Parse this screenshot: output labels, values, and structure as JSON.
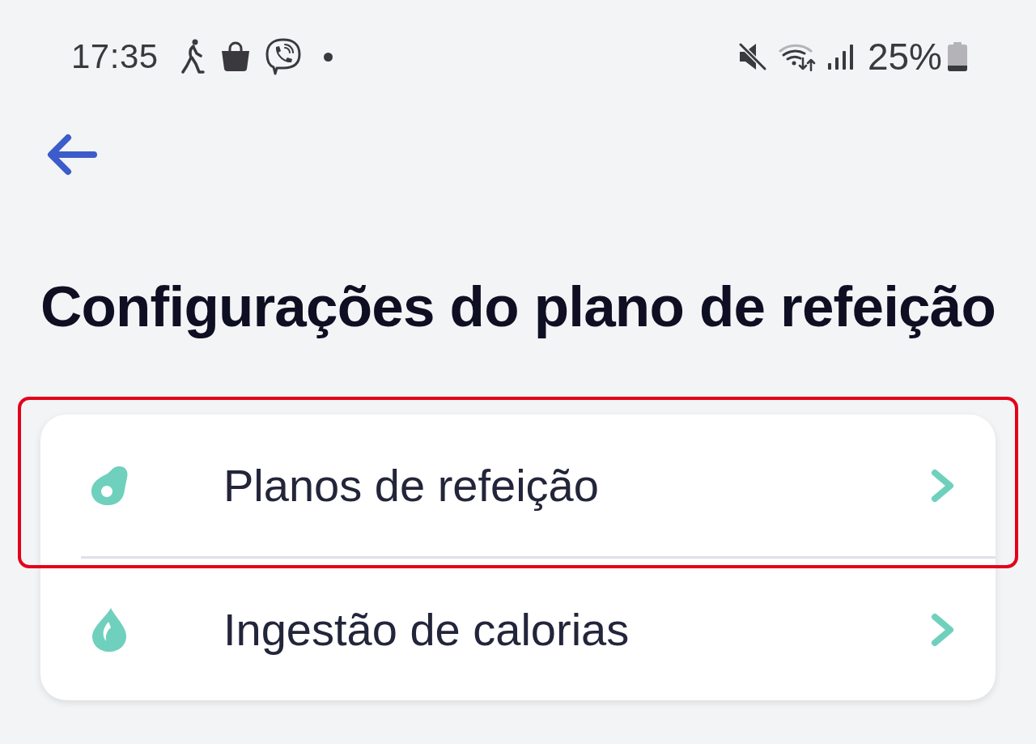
{
  "status_bar": {
    "time": "17:35",
    "battery": "25%"
  },
  "title": "Configurações do plano de refeição",
  "settings": [
    {
      "kind": "meal-plans",
      "label": "Planos de refeição",
      "highlighted": true
    },
    {
      "kind": "calories",
      "label": "Ingestão de calorias",
      "highlighted": false
    }
  ]
}
